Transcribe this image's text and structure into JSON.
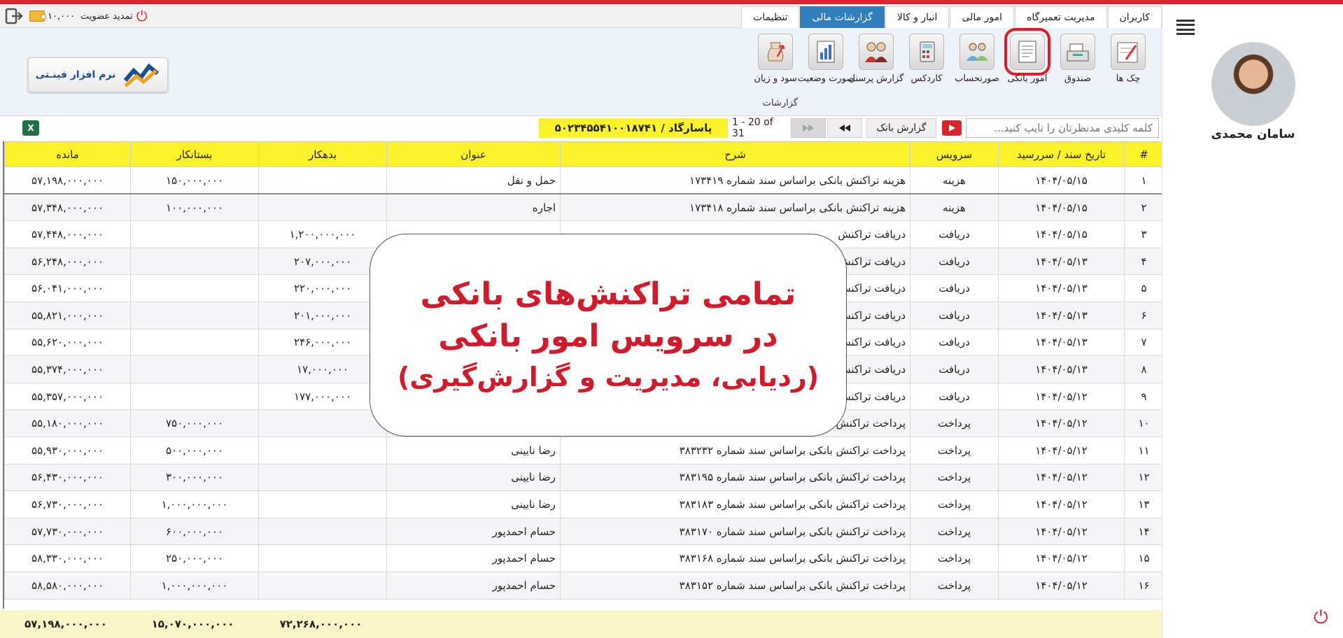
{
  "header": {
    "tabs": [
      {
        "label": "کاربران",
        "active": false
      },
      {
        "label": "مدیریت تعمیرگاه",
        "active": false
      },
      {
        "label": "امور مالی",
        "active": false
      },
      {
        "label": "انبار و کالا",
        "active": false
      },
      {
        "label": "گزارشات مالی",
        "active": true
      },
      {
        "label": "تنظیمات",
        "active": false
      }
    ],
    "credit": "۱۰,۰۰۰",
    "renew_label": "تمدید عضویت"
  },
  "ribbon": {
    "items": [
      {
        "label": "چک ها",
        "icon": "cheque-icon"
      },
      {
        "label": "صندوق",
        "icon": "cash-register-icon"
      },
      {
        "label": "امور بانکی",
        "icon": "bank-document-icon",
        "selected": true
      },
      {
        "label": "صورتحساب",
        "icon": "people-icon"
      },
      {
        "label": "کاردکس",
        "icon": "calculator-icon"
      },
      {
        "label": "گزارش پرسنل",
        "icon": "staff-icon"
      },
      {
        "label": "صورت وضعیت",
        "icon": "chart-document-icon"
      },
      {
        "label": "سود و زیان",
        "icon": "money-bag-icon"
      }
    ],
    "caption": "گزارشات",
    "logo_text": "نرم افزار فینـتی"
  },
  "toolbar": {
    "search_placeholder": "کلمه کلیدی مدنظرتان را تایپ کنید...",
    "report_label": "گزارش بانک",
    "pager": "1 - 20 of 31",
    "account": "پاسارگاد / ۵۰۲۳۴۵۵۴۱۰۰۱۸۷۴۱"
  },
  "table": {
    "headers": {
      "num": "#",
      "date": "تاریخ سند / سررسید",
      "service": "سرویس",
      "desc": "شرح",
      "title": "عنوان",
      "debit": "بدهکار",
      "credit": "بستانکار",
      "balance": "مانده"
    },
    "rows": [
      {
        "num": "۱",
        "date": "۱۴۰۴/۰۵/۱۵",
        "service": "هزینه",
        "desc": "هزینه تراکنش بانکی براساس سند شماره ۱۷۳۴۱۹",
        "title": "حمل و نقل",
        "debit": "",
        "credit": "۱۵۰,۰۰۰,۰۰۰",
        "balance": "۵۷,۱۹۸,۰۰۰,۰۰۰"
      },
      {
        "num": "۲",
        "date": "۱۴۰۴/۰۵/۱۵",
        "service": "هزینه",
        "desc": "هزینه تراکنش بانکی براساس سند شماره ۱۷۳۴۱۸",
        "title": "اجاره",
        "debit": "",
        "credit": "۱۰۰,۰۰۰,۰۰۰",
        "balance": "۵۷,۳۴۸,۰۰۰,۰۰۰"
      },
      {
        "num": "۳",
        "date": "۱۴۰۴/۰۵/۱۵",
        "service": "دریافت",
        "desc": "دریافت تراکنش",
        "title": "",
        "debit": "۱,۲۰۰,۰۰۰,۰۰۰",
        "credit": "",
        "balance": "۵۷,۴۴۸,۰۰۰,۰۰۰"
      },
      {
        "num": "۴",
        "date": "۱۴۰۴/۰۵/۱۳",
        "service": "دریافت",
        "desc": "دریافت تراکنش",
        "title": "",
        "debit": "۲۰۷,۰۰۰,۰۰۰",
        "credit": "",
        "balance": "۵۶,۲۴۸,۰۰۰,۰۰۰"
      },
      {
        "num": "۵",
        "date": "۱۴۰۴/۰۵/۱۳",
        "service": "دریافت",
        "desc": "دریافت تراکنش",
        "title": "",
        "debit": "۲۲۰,۰۰۰,۰۰۰",
        "credit": "",
        "balance": "۵۶,۰۴۱,۰۰۰,۰۰۰"
      },
      {
        "num": "۶",
        "date": "۱۴۰۴/۰۵/۱۳",
        "service": "دریافت",
        "desc": "دریافت تراکنش",
        "title": "",
        "debit": "۲۰۱,۰۰۰,۰۰۰",
        "credit": "",
        "balance": "۵۵,۸۲۱,۰۰۰,۰۰۰"
      },
      {
        "num": "۷",
        "date": "۱۴۰۴/۰۵/۱۳",
        "service": "دریافت",
        "desc": "دریافت تراکنش",
        "title": "",
        "debit": "۲۴۶,۰۰۰,۰۰۰",
        "credit": "",
        "balance": "۵۵,۶۲۰,۰۰۰,۰۰۰"
      },
      {
        "num": "۸",
        "date": "۱۴۰۴/۰۵/۱۳",
        "service": "دریافت",
        "desc": "دریافت تراکنش",
        "title": "",
        "debit": "۱۷,۰۰۰,۰۰۰",
        "credit": "",
        "balance": "۵۵,۳۷۴,۰۰۰,۰۰۰"
      },
      {
        "num": "۹",
        "date": "۱۴۰۴/۰۵/۱۲",
        "service": "دریافت",
        "desc": "دریافت تراکنش",
        "title": "",
        "debit": "۱۷۷,۰۰۰,۰۰۰",
        "credit": "",
        "balance": "۵۵,۳۵۷,۰۰۰,۰۰۰"
      },
      {
        "num": "۱۰",
        "date": "۱۴۰۴/۰۵/۱۲",
        "service": "پرداخت",
        "desc": "پرداخت تراکنش",
        "title": "",
        "debit": "",
        "credit": "۷۵۰,۰۰۰,۰۰۰",
        "balance": "۵۵,۱۸۰,۰۰۰,۰۰۰"
      },
      {
        "num": "۱۱",
        "date": "۱۴۰۴/۰۵/۱۲",
        "service": "پرداخت",
        "desc": "پرداخت تراکنش بانکی براساس سند شماره ۳۸۳۲۳۲",
        "title": "رضا نایینی",
        "debit": "",
        "credit": "۵۰۰,۰۰۰,۰۰۰",
        "balance": "۵۵,۹۳۰,۰۰۰,۰۰۰"
      },
      {
        "num": "۱۲",
        "date": "۱۴۰۴/۰۵/۱۲",
        "service": "پرداخت",
        "desc": "پرداخت تراکنش بانکی براساس سند شماره ۳۸۳۱۹۵",
        "title": "رضا نایینی",
        "debit": "",
        "credit": "۳۰۰,۰۰۰,۰۰۰",
        "balance": "۵۶,۴۳۰,۰۰۰,۰۰۰"
      },
      {
        "num": "۱۳",
        "date": "۱۴۰۴/۰۵/۱۲",
        "service": "پرداخت",
        "desc": "پرداخت تراکنش بانکی براساس سند شماره ۳۸۳۱۸۳",
        "title": "رضا نایینی",
        "debit": "",
        "credit": "۱,۰۰۰,۰۰۰,۰۰۰",
        "balance": "۵۶,۷۳۰,۰۰۰,۰۰۰"
      },
      {
        "num": "۱۴",
        "date": "۱۴۰۴/۰۵/۱۲",
        "service": "پرداخت",
        "desc": "پرداخت تراکنش بانکی براساس سند شماره ۳۸۳۱۷۰",
        "title": "حسام احمدپور",
        "debit": "",
        "credit": "۶۰۰,۰۰۰,۰۰۰",
        "balance": "۵۷,۷۳۰,۰۰۰,۰۰۰"
      },
      {
        "num": "۱۵",
        "date": "۱۴۰۴/۰۵/۱۲",
        "service": "پرداخت",
        "desc": "پرداخت تراکنش بانکی براساس سند شماره ۳۸۳۱۶۸",
        "title": "حسام احمدپور",
        "debit": "",
        "credit": "۲۵۰,۰۰۰,۰۰۰",
        "balance": "۵۸,۳۳۰,۰۰۰,۰۰۰"
      },
      {
        "num": "۱۶",
        "date": "۱۴۰۴/۰۵/۱۲",
        "service": "پرداخت",
        "desc": "پرداخت تراکنش بانکی براساس سند شماره ۳۸۳۱۵۲",
        "title": "حسام احمدپور",
        "debit": "",
        "credit": "۱,۰۰۰,۰۰۰,۰۰۰",
        "balance": "۵۸,۵۸۰,۰۰۰,۰۰۰"
      }
    ],
    "totals": {
      "debit": "۷۲,۲۶۸,۰۰۰,۰۰۰",
      "credit": "۱۵,۰۷۰,۰۰۰,۰۰۰",
      "balance": "۵۷,۱۹۸,۰۰۰,۰۰۰"
    }
  },
  "overlay": {
    "line1": "تمامی تراکنش‌های بانکی",
    "line2": "در سرویس امور بانکی",
    "line3": "(ردیابی، مدیریت و گزارش‌گیری)"
  },
  "user": {
    "name": "سامان محمدی"
  },
  "colors": {
    "accent_red": "#d9262e",
    "tab_active": "#2f7fbf",
    "header_yellow": "#fbf22a",
    "overlay_text": "#d11a2a"
  }
}
